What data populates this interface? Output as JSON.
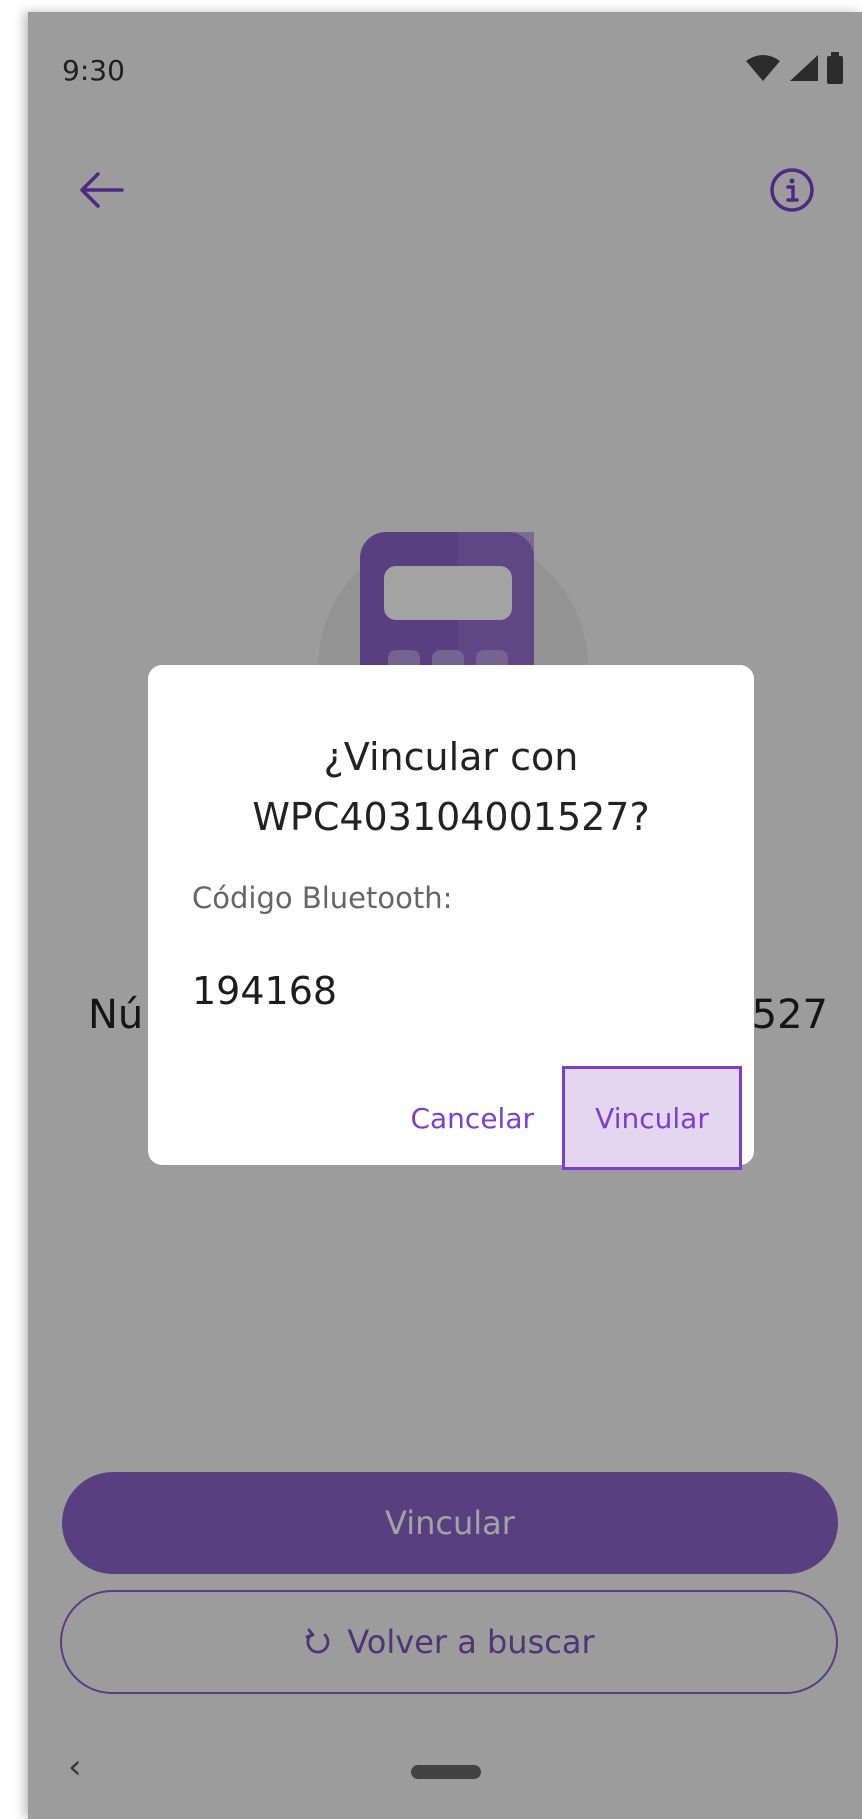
{
  "status_bar": {
    "time": "9:30",
    "icons": [
      "wifi-icon",
      "cellular-signal-icon",
      "battery-icon"
    ]
  },
  "top_bar": {
    "back_icon": "arrow-left-icon",
    "info_icon": "info-icon"
  },
  "illustration": {
    "icon": "device-terminal-icon"
  },
  "caption": {
    "prefix": "Nú",
    "suffix": "527"
  },
  "buttons": {
    "primary_label": "Vincular",
    "secondary_label": "Volver a buscar",
    "secondary_icon": "refresh-icon"
  },
  "dialog": {
    "title_line1": "¿Vincular con",
    "title_line2": "WPC403104001527?",
    "code_label": "Código Bluetooth:",
    "code_value": "194168",
    "cancel_label": "Cancelar",
    "confirm_label": "Vincular"
  },
  "nav_bar": {
    "back_glyph": "‹"
  },
  "colors": {
    "accent": "#7a3fd0",
    "primary_button": "#8a63c8",
    "confirm_highlight": "#e4d6ef",
    "scrim": "rgba(0,0,0,0.36)"
  }
}
